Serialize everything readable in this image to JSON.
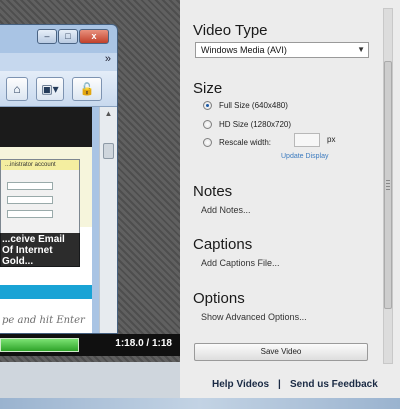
{
  "preview": {
    "window_buttons": [
      "–",
      "□",
      "x"
    ],
    "email_text": [
      "...ceive Email",
      "Of Internet",
      "Gold..."
    ],
    "search_text": "pe and hit Enter",
    "dialog_title": "...inistrator account",
    "playback": {
      "progress": 0.44,
      "time": "1:18.0 / 1:18"
    }
  },
  "panel": {
    "video_type": {
      "heading": "Video Type",
      "selected": "Windows Media (AVI)"
    },
    "size": {
      "heading": "Size",
      "options": [
        "Full Size (640x480)",
        "HD Size (1280x720)",
        "Rescale width:"
      ],
      "selected_index": 0,
      "rescale_unit": "px",
      "update_link": "Update Display"
    },
    "notes": {
      "heading": "Notes",
      "link": "Add Notes..."
    },
    "captions": {
      "heading": "Captions",
      "link": "Add Captions File..."
    },
    "options": {
      "heading": "Options",
      "link": "Show Advanced Options..."
    },
    "save_button": "Save Video"
  },
  "footer": {
    "help": "Help Videos",
    "separator": "|",
    "feedback": "Send us Feedback"
  },
  "colors": {
    "progress": "#2ea329",
    "link": "#3c7bbf",
    "web_blue": "#19a3d5"
  }
}
